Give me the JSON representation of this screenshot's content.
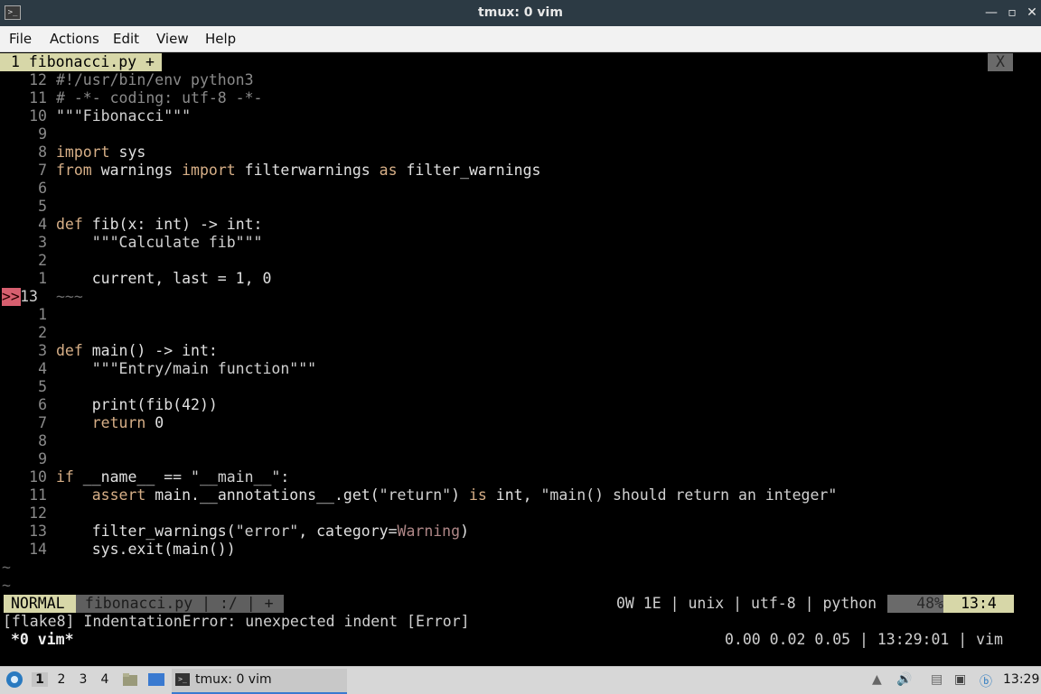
{
  "window": {
    "title": "tmux: 0 vim"
  },
  "menu": [
    "File",
    "Actions",
    "Edit",
    "View",
    "Help"
  ],
  "tab": {
    "label": "1 fibonacci.py +",
    "close": "X"
  },
  "lines": [
    {
      "n": "12",
      "tokens": [
        [
          "cm",
          "#!/usr/bin/env python3"
        ]
      ]
    },
    {
      "n": "11",
      "tokens": [
        [
          "cm",
          "# -*- coding: utf-8 -*-"
        ]
      ]
    },
    {
      "n": "10",
      "tokens": [
        [
          "str",
          "\"\"\"Fibonacci\"\"\""
        ]
      ]
    },
    {
      "n": "9",
      "tokens": []
    },
    {
      "n": "8",
      "tokens": [
        [
          "kw",
          "import"
        ],
        [
          "fnc",
          " sys"
        ]
      ]
    },
    {
      "n": "7",
      "tokens": [
        [
          "kw",
          "from"
        ],
        [
          "fnc",
          " warnings "
        ],
        [
          "kw",
          "import"
        ],
        [
          "fnc",
          " filterwarnings "
        ],
        [
          "kw",
          "as"
        ],
        [
          "fnc",
          " filter_warnings"
        ]
      ]
    },
    {
      "n": "6",
      "tokens": []
    },
    {
      "n": "5",
      "tokens": []
    },
    {
      "n": "4",
      "tokens": [
        [
          "kw",
          "def"
        ],
        [
          "fnc",
          " fib(x: int) -> int:"
        ]
      ]
    },
    {
      "n": "3",
      "tokens": [
        [
          "str",
          "    \"\"\"Calculate fib\"\"\""
        ]
      ]
    },
    {
      "n": "2",
      "tokens": []
    },
    {
      "n": "1",
      "tokens": [
        [
          "fnc",
          "    current, last = 1, 0"
        ]
      ]
    },
    {
      "n": "13",
      "sign": ">>",
      "tokens": [
        [
          "tilde",
          "~~~"
        ]
      ]
    },
    {
      "n": "1",
      "tokens": []
    },
    {
      "n": "2",
      "tokens": []
    },
    {
      "n": "3",
      "tokens": [
        [
          "kw",
          "def"
        ],
        [
          "fnc",
          " main() -> int:"
        ]
      ]
    },
    {
      "n": "4",
      "tokens": [
        [
          "str",
          "    \"\"\"Entry/main function\"\"\""
        ]
      ]
    },
    {
      "n": "5",
      "tokens": []
    },
    {
      "n": "6",
      "tokens": [
        [
          "fnc",
          "    print(fib(42))"
        ]
      ]
    },
    {
      "n": "7",
      "tokens": [
        [
          "kw",
          "    return"
        ],
        [
          "fnc",
          " 0"
        ]
      ]
    },
    {
      "n": "8",
      "tokens": []
    },
    {
      "n": "9",
      "tokens": []
    },
    {
      "n": "10",
      "tokens": [
        [
          "kw",
          "if"
        ],
        [
          "fnc",
          " __name__ == "
        ],
        [
          "str",
          "\"__main__\""
        ],
        [
          "fnc",
          ":"
        ]
      ]
    },
    {
      "n": "11",
      "tokens": [
        [
          "kw",
          "    assert"
        ],
        [
          "fnc",
          " main.__annotations__.get("
        ],
        [
          "str",
          "\"return\""
        ],
        [
          "fnc",
          ") "
        ],
        [
          "kw",
          "is"
        ],
        [
          "fnc",
          " int, "
        ],
        [
          "str",
          "\"main() should return an integer\""
        ]
      ]
    },
    {
      "n": "12",
      "tokens": []
    },
    {
      "n": "13",
      "tokens": [
        [
          "fnc",
          "    filter_warnings("
        ],
        [
          "str",
          "\"error\""
        ],
        [
          "fnc",
          ", category="
        ],
        [
          "warn",
          "Warning"
        ],
        [
          "fnc",
          ")"
        ]
      ]
    },
    {
      "n": "14",
      "tokens": [
        [
          "fnc",
          "    sys.exit(main())"
        ]
      ]
    }
  ],
  "tildes": [
    "~",
    "~"
  ],
  "statusline": {
    "mode": "NORMAL",
    "file": " fibonacci.py | :/ | + ",
    "info": "0W 1E | unix | utf-8 | python ",
    "percent": "48%",
    "position": "13:4"
  },
  "message": "[flake8] IndentationError: unexpected indent [Error]",
  "tmux": {
    "window": "*0 vim*",
    "right": "0.00 0.02 0.05 | 13:29:01 | vim"
  },
  "colors": {
    "tabline": "#d7d7a8",
    "sign": "#d75f6f",
    "mode_bg": "#d7d7a8",
    "file_bg": "#5f5f5f"
  },
  "taskbar": {
    "workspaces": [
      "1",
      "2",
      "3",
      "4"
    ],
    "task_label": "tmux: 0 vim",
    "clock": "13:29"
  }
}
